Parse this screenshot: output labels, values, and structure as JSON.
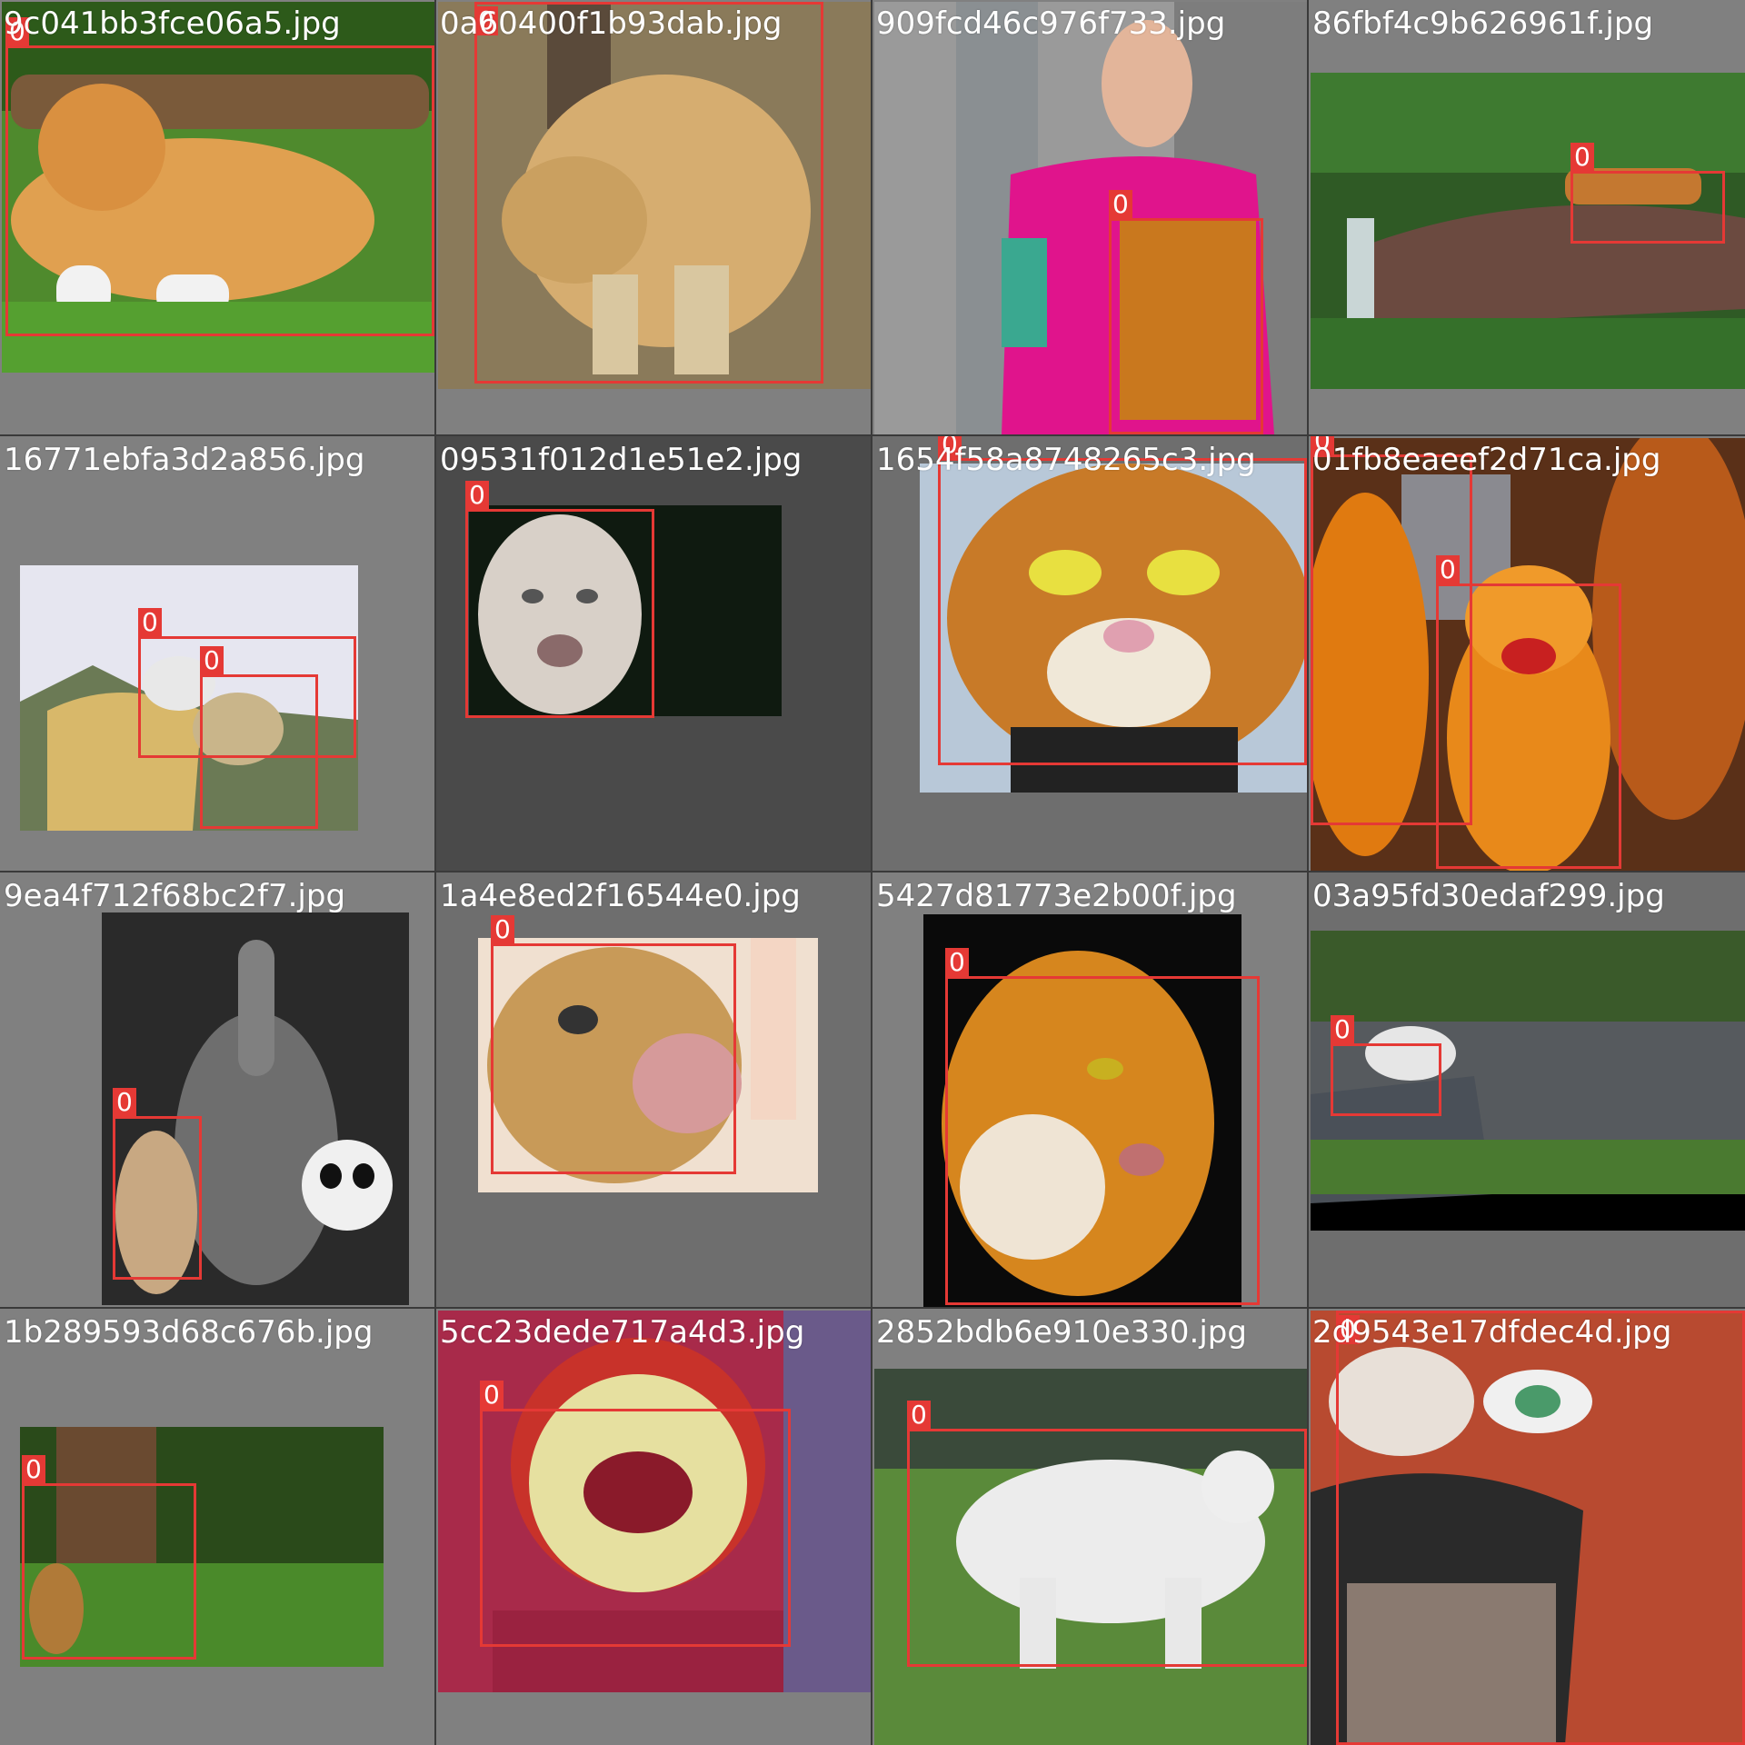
{
  "grid": {
    "columns": 4,
    "rows": 4,
    "box_color": "#e53935",
    "label_color": "#ffffff",
    "tile_bg_colors": [
      "#808080",
      "#6e6e6e",
      "#4a4a4a"
    ]
  },
  "tiles": [
    {
      "filename": "9c041bb3fce06a5.jpg",
      "boxes": [
        {
          "class_id": "0"
        }
      ],
      "scene": "tiger lying on grass"
    },
    {
      "filename": "0a60400f1b93dab.jpg",
      "boxes": [
        {
          "class_id": "0"
        }
      ],
      "scene": "tiger walking in dry grass"
    },
    {
      "filename": "909fcd46c976f733.jpg",
      "boxes": [
        {
          "class_id": "0"
        }
      ],
      "scene": "woman in pink shirt with tiger print"
    },
    {
      "filename": "86fbf4c9b626961f.jpg",
      "boxes": [
        {
          "class_id": "0"
        }
      ],
      "scene": "tiger on rock in zoo enclosure"
    },
    {
      "filename": "16771ebfa3d2a856.jpg",
      "boxes": [
        {
          "class_id": "0"
        },
        {
          "class_id": "0"
        }
      ],
      "scene": "white tiger cubs on stump"
    },
    {
      "filename": "09531f012d1e51e2.jpg",
      "boxes": [
        {
          "class_id": "0"
        }
      ],
      "scene": "white tiger face in dark"
    },
    {
      "filename": "1654f58a8748265c3.jpg",
      "boxes": [
        {
          "class_id": "0"
        }
      ],
      "scene": "painted cartoon tiger reading"
    },
    {
      "filename": "01fb8eaeef2d71ca.jpg",
      "boxes": [
        {
          "class_id": "0"
        },
        {
          "class_id": "0"
        }
      ],
      "scene": "ceramic tiger statues"
    },
    {
      "filename": "9ea4f712f68bc2f7.jpg",
      "boxes": [
        {
          "class_id": "0"
        }
      ],
      "scene": "toy tiger elephant and panda"
    },
    {
      "filename": "1a4e8ed2f16544e0.jpg",
      "boxes": [
        {
          "class_id": "0"
        }
      ],
      "scene": "roaring tiger cub"
    },
    {
      "filename": "5427d81773e2b00f.jpg",
      "boxes": [
        {
          "class_id": "0"
        }
      ],
      "scene": "tiger portrait on black"
    },
    {
      "filename": "03a95fd30edaf299.jpg",
      "boxes": [
        {
          "class_id": "0"
        }
      ],
      "scene": "white tiger near stone wall"
    },
    {
      "filename": "1b289593d68c676b.jpg",
      "boxes": [
        {
          "class_id": "0"
        }
      ],
      "scene": "tiger behind tree trunk"
    },
    {
      "filename": "5cc23dede717a4d3.jpg",
      "boxes": [
        {
          "class_id": "0"
        }
      ],
      "scene": "tiger emblem on red shirt"
    },
    {
      "filename": "2852bdb6e910e330.jpg",
      "boxes": [
        {
          "class_id": "0"
        }
      ],
      "scene": "white tiger standing on grass"
    },
    {
      "filename": "2d9543e17dfdec4d.jpg",
      "boxes": [
        {
          "class_id": "0"
        }
      ],
      "scene": "tiger mural on brick wall"
    }
  ]
}
